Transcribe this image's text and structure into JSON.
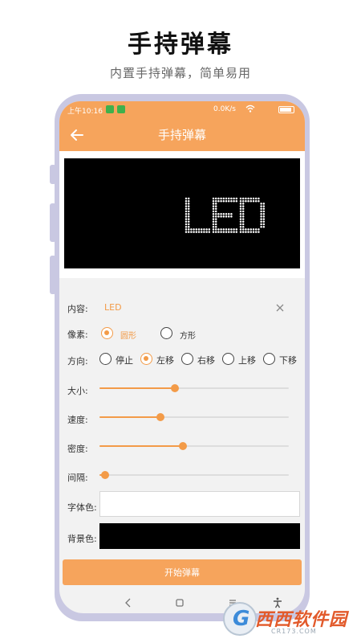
{
  "promo": {
    "title": "手持弹幕",
    "subtitle": "内置手持弹幕，简单易用"
  },
  "status_bar": {
    "time": "上午10:16",
    "speed": "0.0K/s",
    "battery": "100"
  },
  "app_bar": {
    "title": "手持弹幕",
    "back_icon": "arrow-left-icon"
  },
  "led_display": {
    "text": "LED",
    "text_color": "#ffffff",
    "background_color": "#000000"
  },
  "form": {
    "content": {
      "label": "内容:",
      "value": "LED"
    },
    "pixel": {
      "label": "像素:",
      "options": [
        {
          "label": "圆形",
          "selected": true
        },
        {
          "label": "方形",
          "selected": false
        }
      ]
    },
    "direction": {
      "label": "方向:",
      "options": [
        {
          "label": "停止",
          "selected": false
        },
        {
          "label": "左移",
          "selected": true
        },
        {
          "label": "右移",
          "selected": false
        },
        {
          "label": "上移",
          "selected": false
        },
        {
          "label": "下移",
          "selected": false
        }
      ]
    },
    "size": {
      "label": "大小:",
      "value": 0.4
    },
    "speed": {
      "label": "速度:",
      "value": 0.32
    },
    "density": {
      "label": "密度:",
      "value": 0.44
    },
    "spacing": {
      "label": "间隔:",
      "value": 0.03
    },
    "font_color": {
      "label": "字体色:",
      "value": "#ffffff"
    },
    "background_color": {
      "label": "背景色:",
      "value": "#000000"
    },
    "start_label": "开始弹幕"
  },
  "theme": {
    "accent": "#f6a45c",
    "accent_dark": "#f39b48",
    "frame": "#c9c8e2"
  },
  "watermark": {
    "brand": "西西软件园",
    "url": "CR173.COM"
  }
}
